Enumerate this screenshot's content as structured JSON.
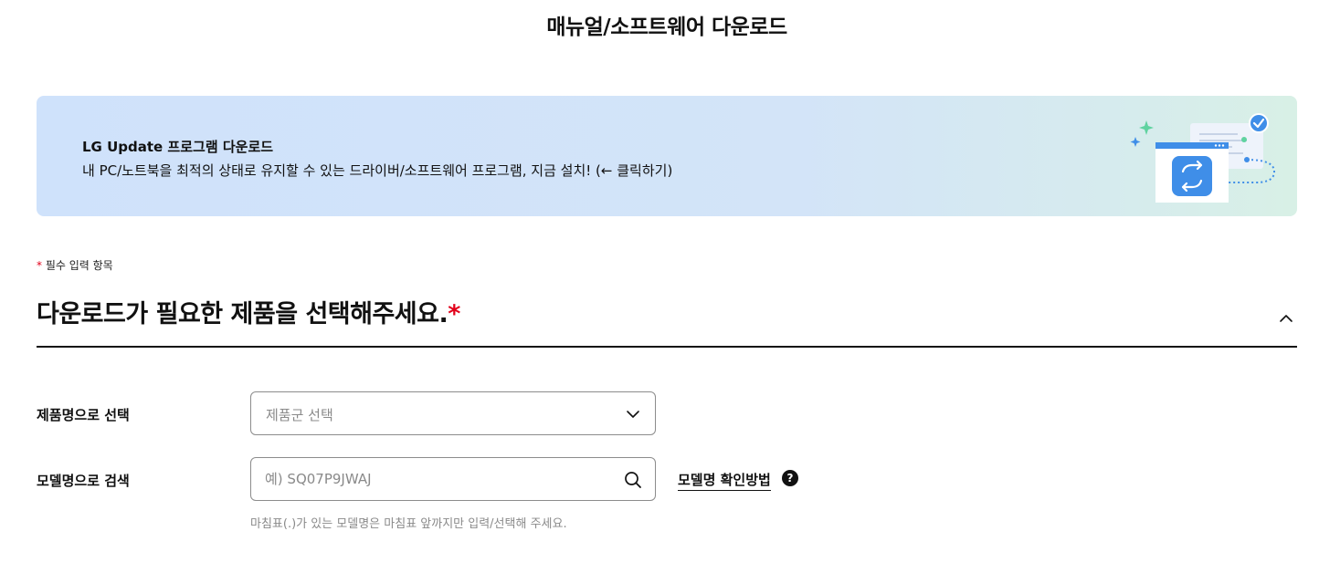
{
  "page": {
    "title": "매뉴얼/소프트웨어 다운로드"
  },
  "banner": {
    "title": "LG Update 프로그램 다운로드",
    "description": "내 PC/노트북을 최적의 상태로 유지할 수 있는 드라이버/소프트웨어 프로그램, 지금 설치! (← 클릭하기)",
    "illustration_icon": "update-app-icon",
    "colors": {
      "gradient_start": "#cfe2fb",
      "gradient_end": "#d8f0e6",
      "app_icon": "#3f8ee8",
      "check_badge": "#3f8ee8",
      "sparkle": "#5fd3a0"
    }
  },
  "form": {
    "required_note": {
      "star": "*",
      "text": "필수 입력 항목"
    },
    "section_title": "다운로드가 필요한 제품을 선택해주세요.",
    "section_required_star": "*",
    "collapse_icon": "chevron-up-icon",
    "product_select": {
      "label": "제품명으로 선택",
      "placeholder": "제품군 선택",
      "icon": "chevron-down-icon"
    },
    "model_search": {
      "label": "모델명으로 검색",
      "placeholder": "예) SQ07P9JWAJ",
      "value": "",
      "icon": "search-icon",
      "help_link": "모델명 확인방법",
      "help_icon": "?",
      "hint": "마침표(.)가 있는 모델명은 마침표 앞까지만 입력/선택해 주세요."
    }
  },
  "colors": {
    "required_star": "#e2001a",
    "hint_text": "#8a8a8a",
    "border": "#8c8c8c"
  }
}
